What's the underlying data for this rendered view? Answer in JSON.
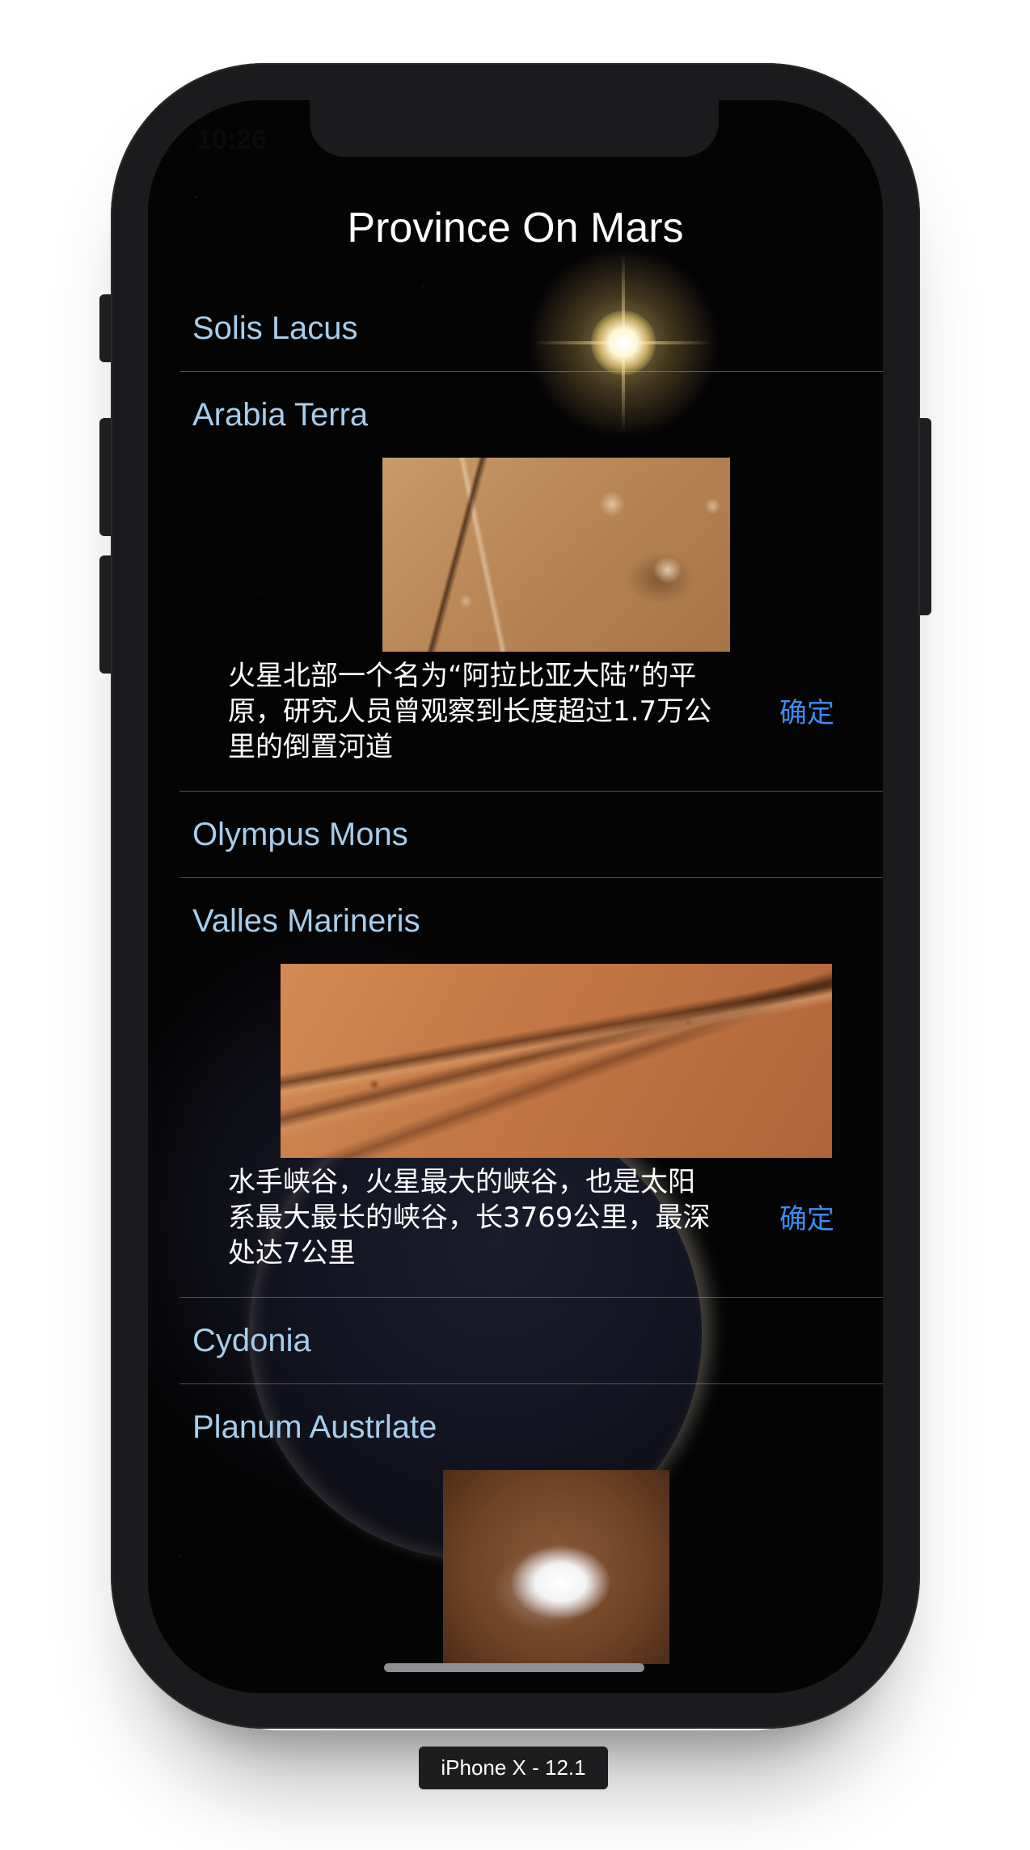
{
  "status_bar": {
    "time": "10:26"
  },
  "page": {
    "title": "Province On Mars"
  },
  "provinces": [
    {
      "name": "Solis Lacus"
    },
    {
      "name": "Arabia Terra",
      "description": "火星北部一个名为“阿拉比亚大陆”的平原，研究人员曾观察到长度超过1.7万公里的倒置河道",
      "confirm_label": "确定"
    },
    {
      "name": "Olympus Mons"
    },
    {
      "name": "Valles Marineris",
      "description": "水手峡谷，火星最大的峡谷，也是太阳系最大最长的峡谷，长3769公里，最深处达7公里",
      "confirm_label": "确定"
    },
    {
      "name": "Cydonia"
    },
    {
      "name": "Planum Austrlate"
    }
  ],
  "device": {
    "label": "iPhone X - 12.1"
  },
  "colors": {
    "title_text": "#ffffff",
    "row_text": "#a7cdec",
    "confirm_text": "#3d8cf0",
    "screen_bg": "#050506"
  }
}
